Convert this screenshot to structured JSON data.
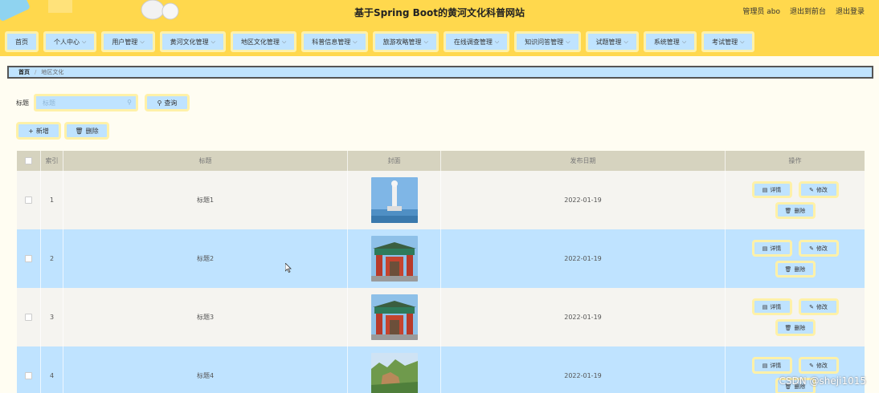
{
  "header": {
    "site_title": "基于Spring Boot的黄河文化科普网站",
    "user_label": "管理员 abo",
    "back_frontend": "退出到前台",
    "logout": "退出登录"
  },
  "nav": {
    "items": [
      {
        "label": "首页",
        "has_menu": false
      },
      {
        "label": "个人中心",
        "has_menu": true
      },
      {
        "label": "用户管理",
        "has_menu": true
      },
      {
        "label": "黄河文化管理",
        "has_menu": true
      },
      {
        "label": "地区文化管理",
        "has_menu": true
      },
      {
        "label": "科普信息管理",
        "has_menu": true
      },
      {
        "label": "旅游攻略管理",
        "has_menu": true
      },
      {
        "label": "在线调查管理",
        "has_menu": true
      },
      {
        "label": "知识问答管理",
        "has_menu": true
      },
      {
        "label": "试题管理",
        "has_menu": true
      },
      {
        "label": "系统管理",
        "has_menu": true
      },
      {
        "label": "考试管理",
        "has_menu": true
      }
    ]
  },
  "breadcrumb": {
    "home": "首页",
    "separator": "/",
    "current": "地区文化"
  },
  "search": {
    "label": "标题",
    "placeholder": "标题",
    "query_button": "查询"
  },
  "actions": {
    "add": "新增",
    "delete": "删除"
  },
  "table": {
    "columns": {
      "index": "索引",
      "title": "标题",
      "cover": "封面",
      "date": "发布日期",
      "ops": "操作"
    },
    "ops_labels": {
      "detail": "详情",
      "edit": "修改",
      "delete": "删除"
    },
    "rows": [
      {
        "index": "1",
        "title": "标题1",
        "date": "2022-01-19",
        "cover": "statue"
      },
      {
        "index": "2",
        "title": "标题2",
        "date": "2022-01-19",
        "cover": "gate"
      },
      {
        "index": "3",
        "title": "标题3",
        "date": "2022-01-19",
        "cover": "gate"
      },
      {
        "index": "4",
        "title": "标题4",
        "date": "2022-01-19",
        "cover": "mountain"
      }
    ]
  },
  "watermark": "CSDN @sheji1015",
  "colors": {
    "accent_yellow": "#ffd84d",
    "light_blue": "#bfe3ff",
    "button_border": "#fff1a8"
  }
}
